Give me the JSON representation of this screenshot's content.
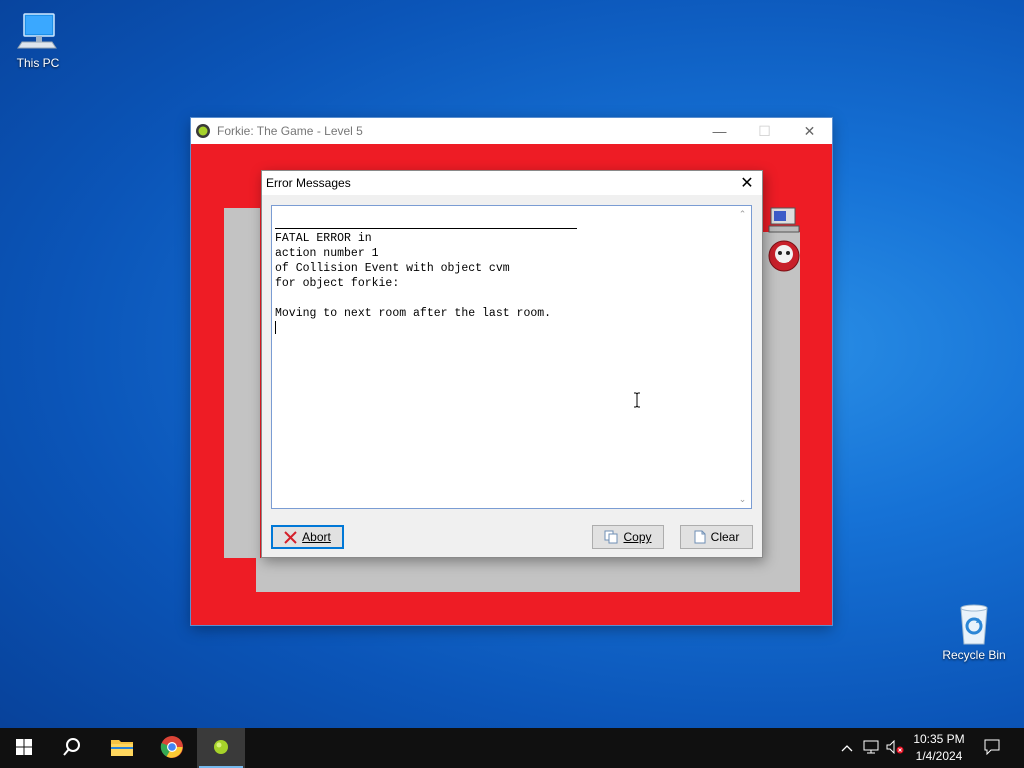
{
  "desktop": {
    "this_pc_label": "This PC",
    "recycle_bin_label": "Recycle Bin"
  },
  "game_window": {
    "title": "Forkie: The Game - Level 5",
    "canvas_color": "#ee1c25"
  },
  "dialog": {
    "title": "Error Messages",
    "message_lines": [
      "FATAL ERROR in",
      "action number 1",
      "of Collision Event with object cvm",
      "for object forkie:",
      "",
      "Moving to next room after the last room."
    ],
    "buttons": {
      "abort": "Abort",
      "copy": "Copy",
      "clear": "Clear"
    }
  },
  "taskbar": {
    "time": "10:35 PM",
    "date": "1/4/2024",
    "apps": [
      "start-button",
      "search",
      "file-explorer",
      "chrome",
      "game-maker"
    ],
    "active_app": "game-maker"
  },
  "colors": {
    "accent": "#0078d7",
    "game_red": "#ee1c25"
  }
}
